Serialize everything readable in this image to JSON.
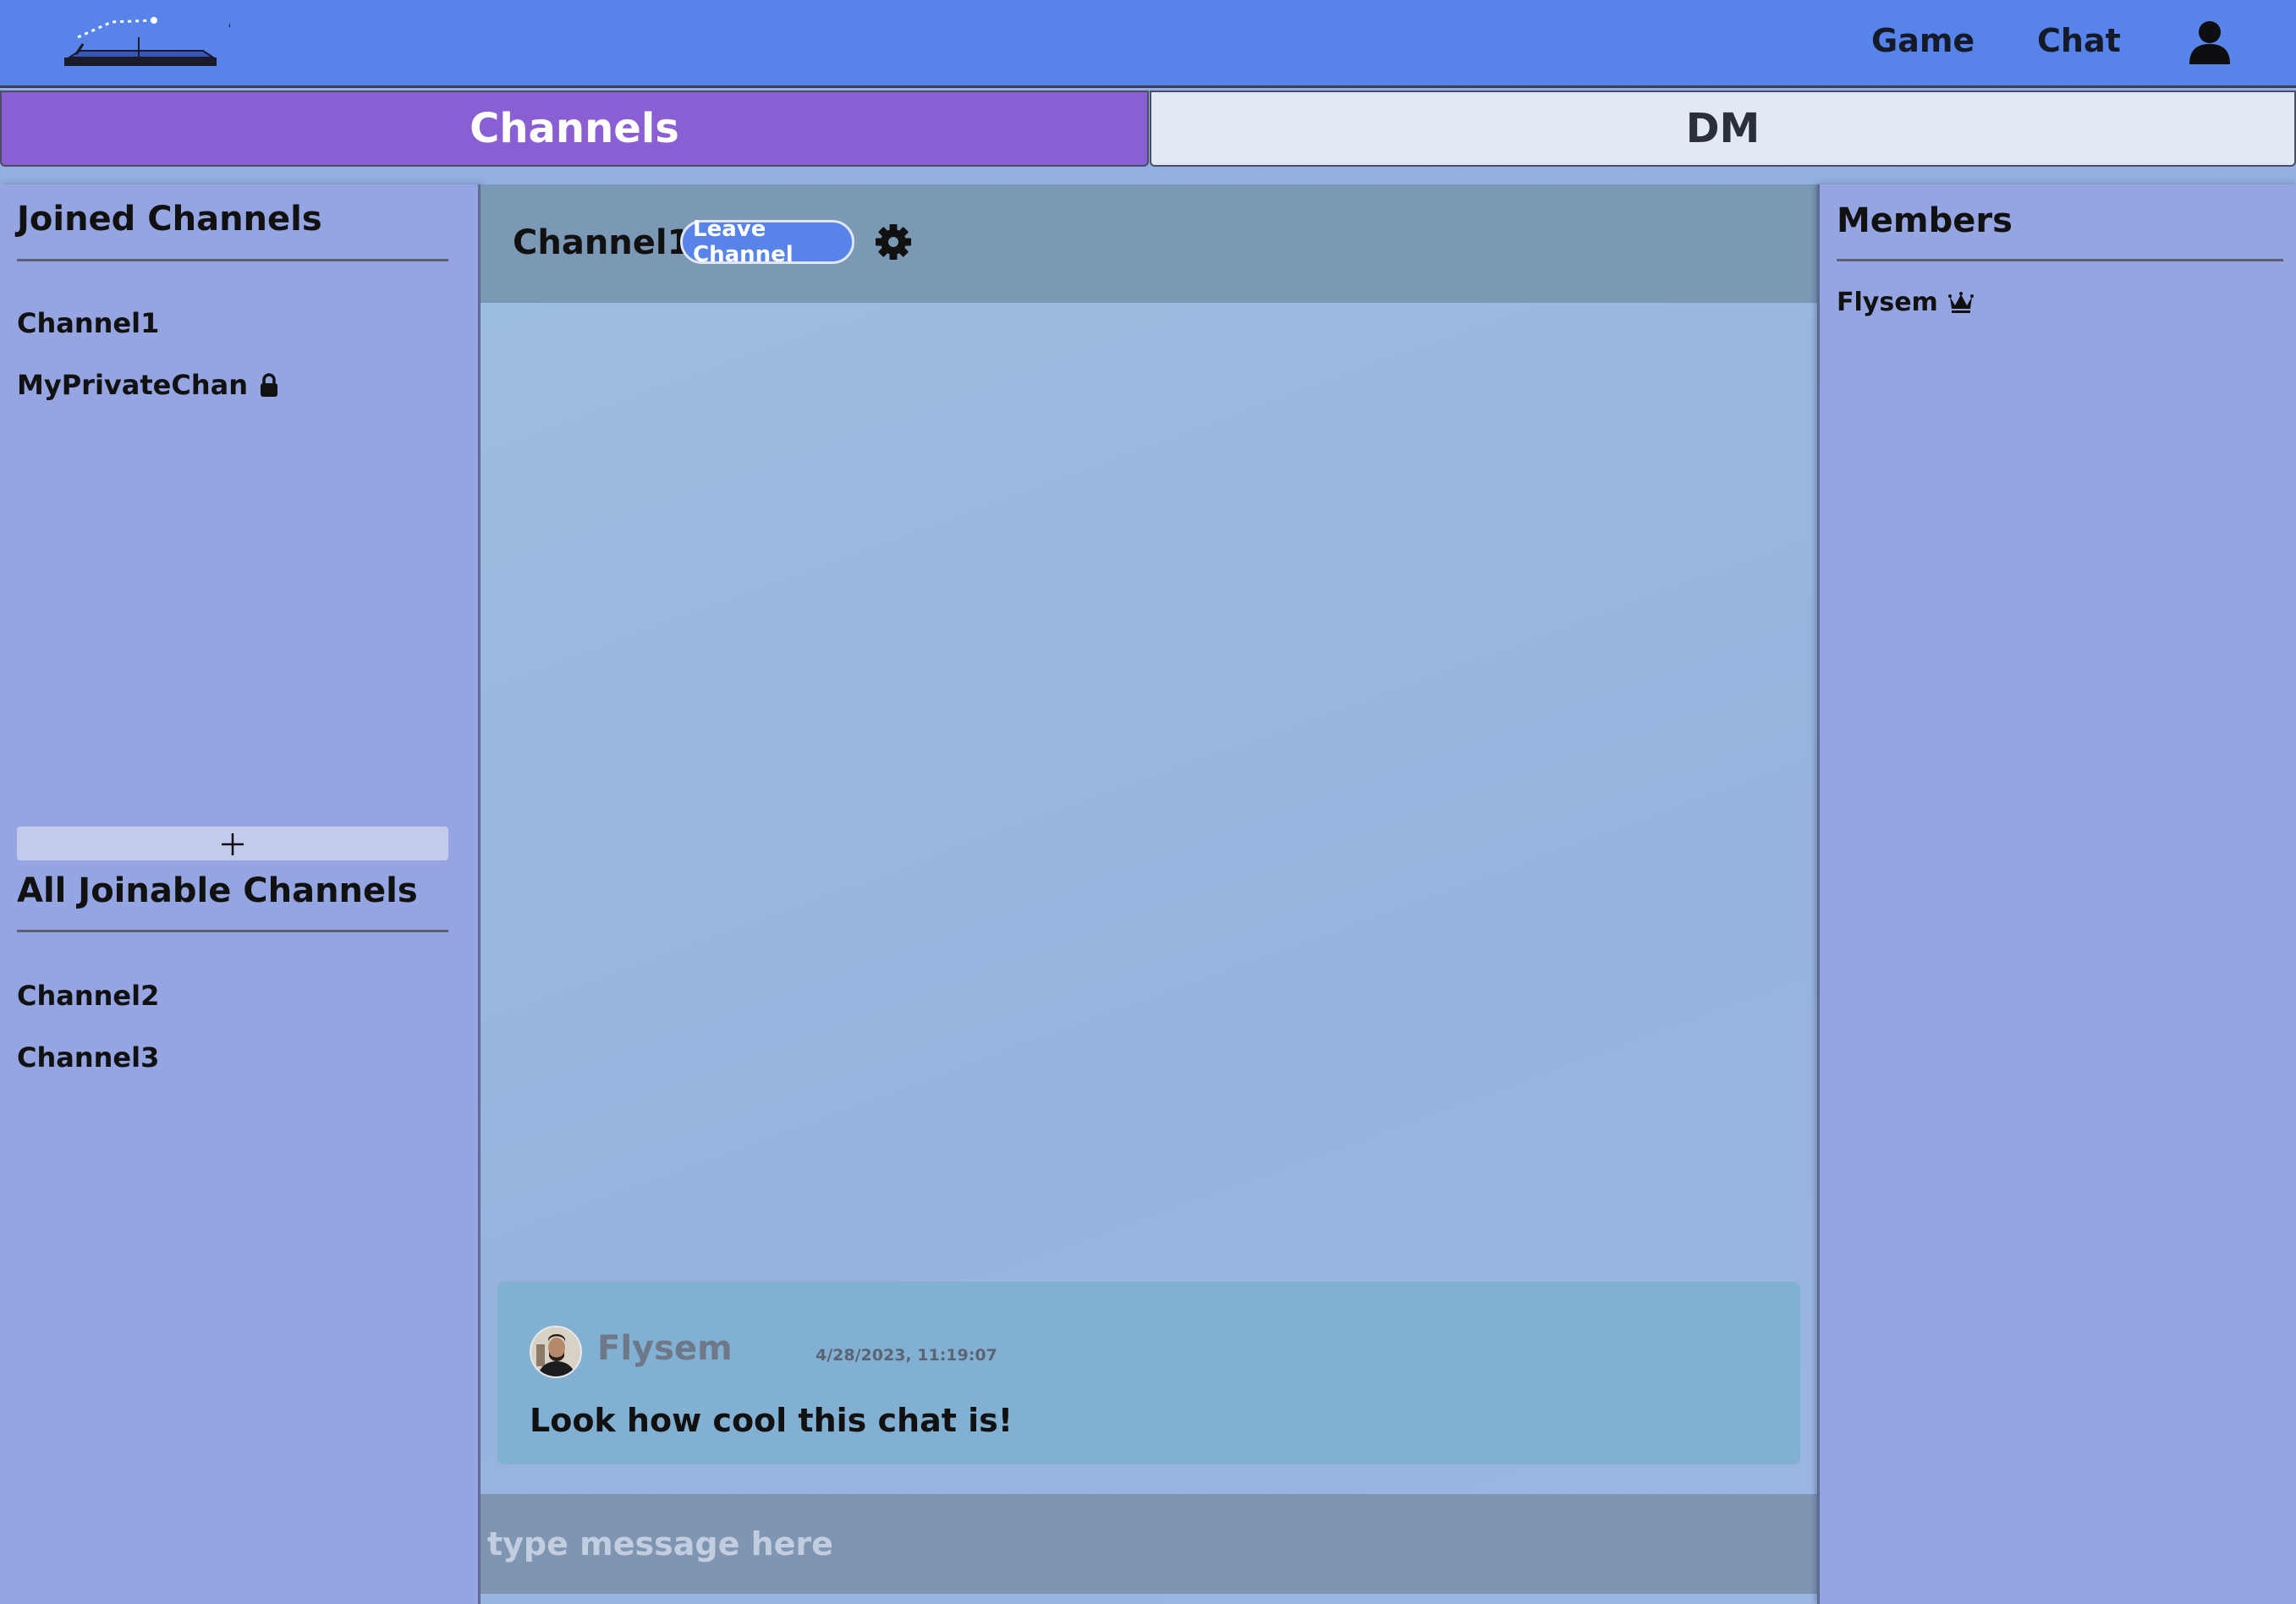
{
  "navbar": {
    "links": [
      {
        "label": "Game"
      },
      {
        "label": "Chat"
      }
    ],
    "user_icon": "user-icon",
    "logo_icon": "pong-table-logo"
  },
  "tabs": [
    {
      "label": "Channels",
      "active": true
    },
    {
      "label": "DM",
      "active": false
    }
  ],
  "left_panel": {
    "joined_title": "Joined Channels",
    "joined_channels": [
      {
        "name": "Channel1",
        "private": false
      },
      {
        "name": "MyPrivateChan",
        "private": true,
        "icon": "lock-icon"
      }
    ],
    "add_button_icon": "plus-icon",
    "joinable_title": "All Joinable Channels",
    "joinable_channels": [
      {
        "name": "Channel2"
      },
      {
        "name": "Channel3"
      }
    ]
  },
  "chat": {
    "channel_name": "Channel1",
    "leave_label": "Leave Channel",
    "settings_icon": "gear-icon",
    "messages": [
      {
        "author": "Flysem",
        "timestamp": "4/28/2023, 11:19:07",
        "text": "Look how cool this chat is!"
      }
    ],
    "input_placeholder": "type message here"
  },
  "members": {
    "title": "Members",
    "list": [
      {
        "name": "Flysem",
        "role_icon": "crown-icon"
      }
    ]
  },
  "colors": {
    "navbar": "#5883e8",
    "active_tab": "#8b5fd4",
    "inactive_tab": "#e1eaf4",
    "side_panel": "#95a5e2",
    "chat_header": "#7b98b4",
    "message_bg": "#82b0d2"
  }
}
